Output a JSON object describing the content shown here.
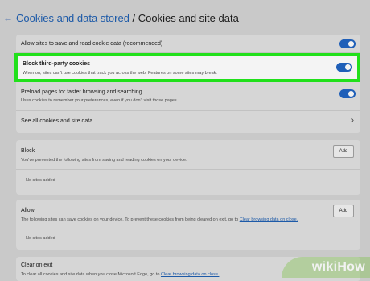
{
  "breadcrumb": {
    "back_icon": "←",
    "parent": "Cookies and data stored",
    "separator": " / ",
    "current": "Cookies and site data"
  },
  "settings": {
    "allow_cookies": {
      "title": "Allow sites to save and read cookie data (recommended)",
      "enabled": true
    },
    "block_third_party": {
      "title": "Block third-party cookies",
      "description": "When on, sites can't use cookies that track you across the web. Features on some sites may break.",
      "enabled": true
    },
    "preload": {
      "title": "Preload pages for faster browsing and searching",
      "description": "Uses cookies to remember your preferences, even if you don't visit those pages",
      "enabled": true
    },
    "see_all": {
      "title": "See all cookies and site data",
      "icon": "chevron-right-icon"
    }
  },
  "block_section": {
    "title": "Block",
    "description": "You've prevented the following sites from saving and reading cookies on your device.",
    "add_label": "Add",
    "empty": "No sites added"
  },
  "allow_section": {
    "title": "Allow",
    "description": "The following sites can save cookies on your device. To prevent these cookies from being cleared on exit, go to",
    "link": "Clear browsing data on close.",
    "add_label": "Add",
    "empty": "No sites added"
  },
  "clear_section": {
    "title": "Clear on exit",
    "description": "To clear all cookies and site data when you close Microsoft Edge, go to",
    "link": "Clear browsing data on close."
  },
  "watermark": {
    "wiki": "wiki",
    "how": "How"
  },
  "colors": {
    "accent": "#1f5fb8",
    "highlight": "#21e01b"
  }
}
